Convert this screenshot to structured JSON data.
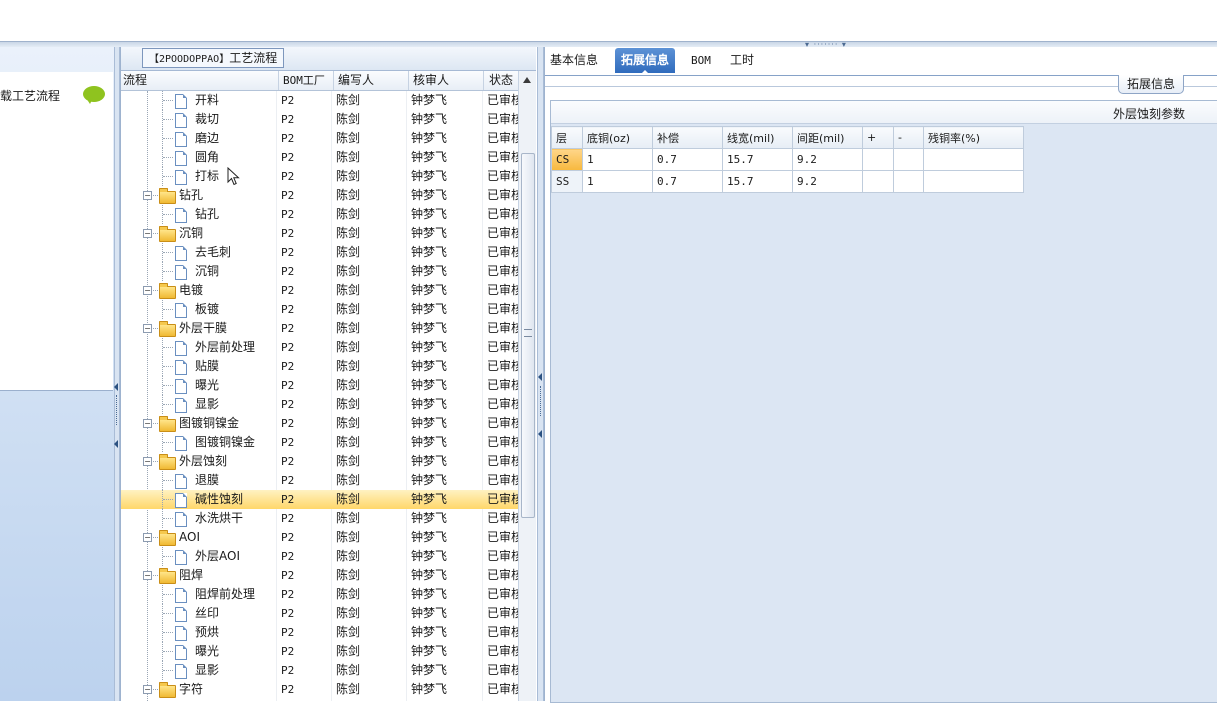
{
  "left_nav": {
    "item_label": "载工艺流程"
  },
  "tree_panel": {
    "title_code": "【2POODOPPAO】",
    "title_text": "工艺流程",
    "columns": {
      "name": "流程",
      "bom": "BOM工厂",
      "writer": "编写人",
      "reviewer": "核审人",
      "status": "状态"
    },
    "rows": [
      {
        "name": "开料",
        "type": "doc",
        "bom": "P2",
        "writer": "陈剑",
        "reviewer": "钟梦飞",
        "status": "已审核"
      },
      {
        "name": "裁切",
        "type": "doc",
        "bom": "P2",
        "writer": "陈剑",
        "reviewer": "钟梦飞",
        "status": "已审核"
      },
      {
        "name": "磨边",
        "type": "doc",
        "bom": "P2",
        "writer": "陈剑",
        "reviewer": "钟梦飞",
        "status": "已审核"
      },
      {
        "name": "圆角",
        "type": "doc",
        "bom": "P2",
        "writer": "陈剑",
        "reviewer": "钟梦飞",
        "status": "已审核"
      },
      {
        "name": "打标",
        "type": "doc",
        "bom": "P2",
        "writer": "陈剑",
        "reviewer": "钟梦飞",
        "status": "已审核"
      },
      {
        "name": "钻孔",
        "type": "folder",
        "bom": "P2",
        "writer": "陈剑",
        "reviewer": "钟梦飞",
        "status": "已审核"
      },
      {
        "name": "钻孔",
        "type": "doc",
        "bom": "P2",
        "writer": "陈剑",
        "reviewer": "钟梦飞",
        "status": "已审核"
      },
      {
        "name": "沉铜",
        "type": "folder",
        "bom": "P2",
        "writer": "陈剑",
        "reviewer": "钟梦飞",
        "status": "已审核"
      },
      {
        "name": "去毛刺",
        "type": "doc",
        "bom": "P2",
        "writer": "陈剑",
        "reviewer": "钟梦飞",
        "status": "已审核"
      },
      {
        "name": "沉铜",
        "type": "doc",
        "bom": "P2",
        "writer": "陈剑",
        "reviewer": "钟梦飞",
        "status": "已审核"
      },
      {
        "name": "电镀",
        "type": "folder",
        "bom": "P2",
        "writer": "陈剑",
        "reviewer": "钟梦飞",
        "status": "已审核"
      },
      {
        "name": "板镀",
        "type": "doc",
        "bom": "P2",
        "writer": "陈剑",
        "reviewer": "钟梦飞",
        "status": "已审核"
      },
      {
        "name": "外层干膜",
        "type": "folder",
        "bom": "P2",
        "writer": "陈剑",
        "reviewer": "钟梦飞",
        "status": "已审核"
      },
      {
        "name": "外层前处理",
        "type": "doc",
        "bom": "P2",
        "writer": "陈剑",
        "reviewer": "钟梦飞",
        "status": "已审核"
      },
      {
        "name": "贴膜",
        "type": "doc",
        "bom": "P2",
        "writer": "陈剑",
        "reviewer": "钟梦飞",
        "status": "已审核"
      },
      {
        "name": "曝光",
        "type": "doc",
        "bom": "P2",
        "writer": "陈剑",
        "reviewer": "钟梦飞",
        "status": "已审核"
      },
      {
        "name": "显影",
        "type": "doc",
        "bom": "P2",
        "writer": "陈剑",
        "reviewer": "钟梦飞",
        "status": "已审核"
      },
      {
        "name": "图镀铜镍金",
        "type": "folder",
        "bom": "P2",
        "writer": "陈剑",
        "reviewer": "钟梦飞",
        "status": "已审核"
      },
      {
        "name": "图镀铜镍金",
        "type": "doc",
        "bom": "P2",
        "writer": "陈剑",
        "reviewer": "钟梦飞",
        "status": "已审核"
      },
      {
        "name": "外层蚀刻",
        "type": "folder",
        "bom": "P2",
        "writer": "陈剑",
        "reviewer": "钟梦飞",
        "status": "已审核"
      },
      {
        "name": "退膜",
        "type": "doc",
        "bom": "P2",
        "writer": "陈剑",
        "reviewer": "钟梦飞",
        "status": "已审核"
      },
      {
        "name": "碱性蚀刻",
        "type": "doc",
        "bom": "P2",
        "writer": "陈剑",
        "reviewer": "钟梦飞",
        "status": "已审核",
        "selected": true
      },
      {
        "name": "水洗烘干",
        "type": "doc",
        "bom": "P2",
        "writer": "陈剑",
        "reviewer": "钟梦飞",
        "status": "已审核"
      },
      {
        "name": "AOI",
        "type": "folder",
        "bom": "P2",
        "writer": "陈剑",
        "reviewer": "钟梦飞",
        "status": "已审核"
      },
      {
        "name": "外层AOI",
        "type": "doc",
        "bom": "P2",
        "writer": "陈剑",
        "reviewer": "钟梦飞",
        "status": "已审核"
      },
      {
        "name": "阻焊",
        "type": "folder",
        "bom": "P2",
        "writer": "陈剑",
        "reviewer": "钟梦飞",
        "status": "已审核"
      },
      {
        "name": "阻焊前处理",
        "type": "doc",
        "bom": "P2",
        "writer": "陈剑",
        "reviewer": "钟梦飞",
        "status": "已审核"
      },
      {
        "name": "丝印",
        "type": "doc",
        "bom": "P2",
        "writer": "陈剑",
        "reviewer": "钟梦飞",
        "status": "已审核"
      },
      {
        "name": "预烘",
        "type": "doc",
        "bom": "P2",
        "writer": "陈剑",
        "reviewer": "钟梦飞",
        "status": "已审核"
      },
      {
        "name": "曝光",
        "type": "doc",
        "bom": "P2",
        "writer": "陈剑",
        "reviewer": "钟梦飞",
        "status": "已审核"
      },
      {
        "name": "显影",
        "type": "doc",
        "bom": "P2",
        "writer": "陈剑",
        "reviewer": "钟梦飞",
        "status": "已审核"
      },
      {
        "name": "字符",
        "type": "folder",
        "bom": "P2",
        "writer": "陈剑",
        "reviewer": "钟梦飞",
        "status": "已审核"
      }
    ]
  },
  "detail_panel": {
    "tabs": [
      {
        "label": "基本信息",
        "active": false
      },
      {
        "label": "拓展信息",
        "active": true
      },
      {
        "label": "BOM",
        "active": false
      },
      {
        "label": "工时",
        "active": false
      }
    ],
    "tab_button": "拓展信息",
    "group_title": "外层蚀刻参数",
    "grid": {
      "headers": [
        "层",
        "底铜(oz)",
        "补偿",
        "线宽(mil)",
        "间距(mil)",
        "+",
        "-",
        "残铜率(%)"
      ],
      "rows": [
        {
          "layer": "CS",
          "base_copper": "1",
          "compensation": "0.7",
          "line_width": "15.7",
          "spacing": "9.2",
          "plus": "",
          "minus": "",
          "residual": ""
        },
        {
          "layer": "SS",
          "base_copper": "1",
          "compensation": "0.7",
          "line_width": "15.7",
          "spacing": "9.2",
          "plus": "",
          "minus": "",
          "residual": ""
        }
      ]
    }
  },
  "colors": {
    "accent": "#2f6bbd",
    "selection": "#ffd76a",
    "folder": "#f0b933",
    "chat_bubble": "#8fc31f"
  }
}
